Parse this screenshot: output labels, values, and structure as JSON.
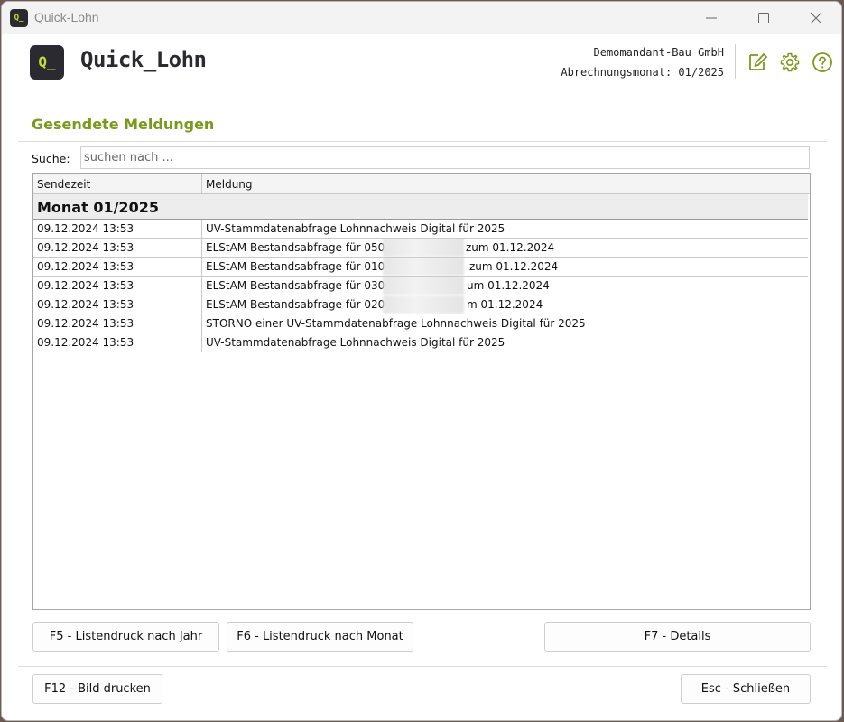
{
  "window": {
    "title": "Quick-Lohn",
    "app_icon": "Q_"
  },
  "header": {
    "logo_mark": "Q_",
    "logo_text": "Quick_Lohn",
    "company": "Demomandant-Bau GmbH",
    "billing_month": "Abrechnungsmonat: 01/2025",
    "icons": [
      "edit-icon",
      "gear-icon",
      "help-icon"
    ],
    "accent_color": "#c4de38"
  },
  "page": {
    "title": "Gesendete Meldungen",
    "title_color": "#7a9a1c"
  },
  "search": {
    "label": "Suche:",
    "placeholder": "suchen nach ...",
    "value": ""
  },
  "table": {
    "columns": [
      "Sendezeit",
      "Meldung"
    ],
    "group": "Monat 01/2025",
    "rows": [
      {
        "time": "09.12.2024 13:53",
        "msg_a": "UV-Stammdatenabfrage Lohnnachweis Digital für 2025",
        "msg_b": ""
      },
      {
        "time": "09.12.2024 13:53",
        "msg_a": "ELStAM-Bestandsabfrage für 0500",
        "msg_b": "zum 01.12.2024"
      },
      {
        "time": "09.12.2024 13:53",
        "msg_a": "ELStAM-Bestandsabfrage für 0100",
        "msg_b": "zum 01.12.2024"
      },
      {
        "time": "09.12.2024 13:53",
        "msg_a": "ELStAM-Bestandsabfrage für 0300",
        "msg_b": "um 01.12.2024"
      },
      {
        "time": "09.12.2024 13:53",
        "msg_a": "ELStAM-Bestandsabfrage für 0200",
        "msg_b": "m 01.12.2024"
      },
      {
        "time": "09.12.2024 13:53",
        "msg_a": "STORNO einer UV-Stammdatenabfrage Lohnnachweis Digital für 2025",
        "msg_b": ""
      },
      {
        "time": "09.12.2024 13:53",
        "msg_a": "UV-Stammdatenabfrage Lohnnachweis Digital für 2025",
        "msg_b": ""
      }
    ]
  },
  "buttons": {
    "f5": "F5 - Listendruck nach Jahr",
    "f6": "F6 - Listendruck nach Monat",
    "f7": "F7 - Details",
    "f12": "F12 - Bild drucken",
    "esc": "Esc - Schließen"
  }
}
